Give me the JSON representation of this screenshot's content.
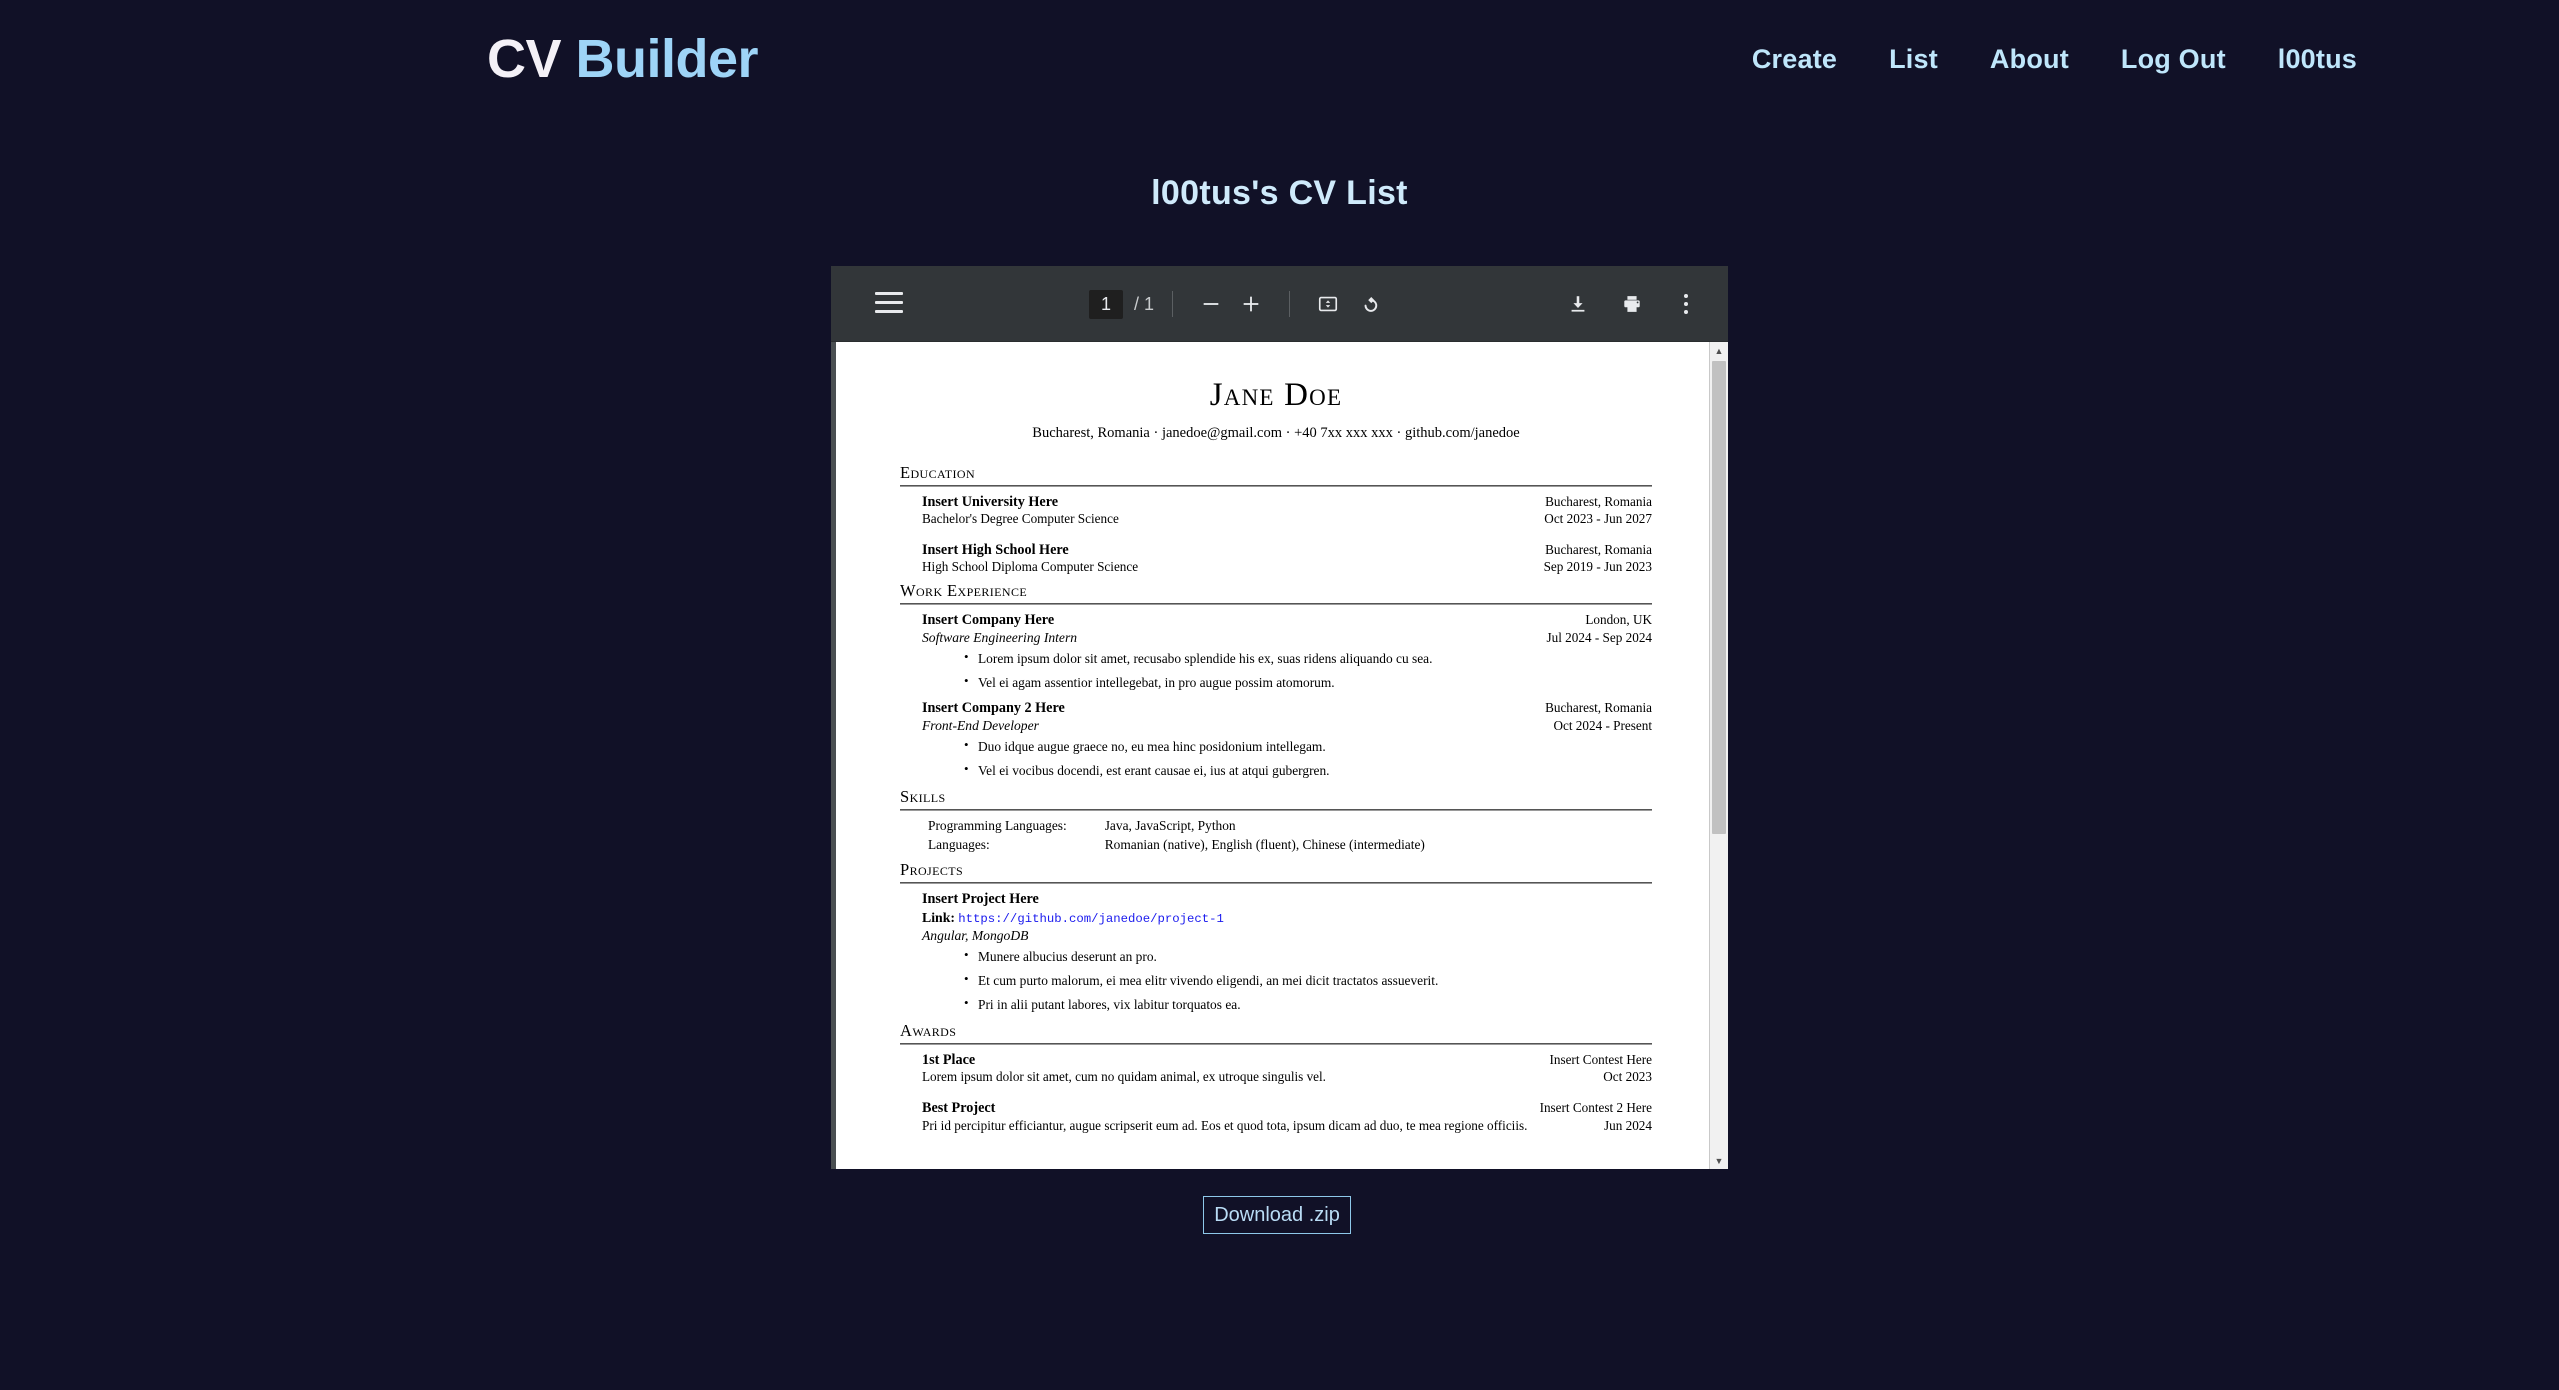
{
  "theme": {
    "background": "#111127",
    "accent": "#9ed4f7",
    "nav_link": "#bfe6fb",
    "toolbar_bg": "#323639"
  },
  "header": {
    "brand_first": "CV",
    "brand_second": "Builder",
    "nav": [
      {
        "label": "Create",
        "name": "nav-create"
      },
      {
        "label": "List",
        "name": "nav-list"
      },
      {
        "label": "About",
        "name": "nav-about"
      },
      {
        "label": "Log Out",
        "name": "nav-log-out"
      },
      {
        "label": "l00tus",
        "name": "nav-username"
      }
    ]
  },
  "page": {
    "title": "l00tus's CV List",
    "download_zip_label": "Download .zip"
  },
  "pdf_toolbar": {
    "menu_icon": "hamburger-menu-icon",
    "page_number": "1",
    "page_total": "/ 1",
    "zoom_out_icon": "minus-icon",
    "zoom_in_icon": "plus-icon",
    "fit_page_icon": "fit-to-page-icon",
    "rotate_icon": "rotate-counterclockwise-icon",
    "download_icon": "download-icon",
    "print_icon": "print-icon",
    "more_icon": "more-options-icon"
  },
  "cv": {
    "name": "Jane Doe",
    "contact": "Bucharest, Romania · janedoe@gmail.com · +40 7xx xxx xxx · github.com/janedoe",
    "sections": {
      "education": {
        "title": "Education",
        "entries": [
          {
            "title": "Insert University Here",
            "location": "Bucharest, Romania",
            "subtitle": "Bachelor's Degree Computer Science",
            "dates": "Oct 2023 - Jun 2027"
          },
          {
            "title": "Insert High School Here",
            "location": "Bucharest, Romania",
            "subtitle": "High School Diploma Computer Science",
            "dates": "Sep 2019 - Jun 2023"
          }
        ]
      },
      "work_experience": {
        "title": "Work Experience",
        "entries": [
          {
            "title": "Insert Company Here",
            "location": "London, UK",
            "subtitle": "Software Engineering Intern",
            "dates": "Jul 2024 - Sep 2024",
            "bullets": [
              "Lorem ipsum dolor sit amet, recusabo splendide his ex, suas ridens aliquando cu sea.",
              "Vel ei agam assentior intellegebat, in pro augue possim atomorum."
            ]
          },
          {
            "title": "Insert Company 2 Here",
            "location": "Bucharest, Romania",
            "subtitle": "Front-End Developer",
            "dates": "Oct 2024 - Present",
            "bullets": [
              "Duo idque augue graece no, eu mea hinc posidonium intellegam.",
              "Vel ei vocibus docendi, est erant causae ei, ius at atqui gubergren."
            ]
          }
        ]
      },
      "skills": {
        "title": "Skills",
        "rows": [
          {
            "key": "Programming Languages:",
            "value": "Java, JavaScript, Python"
          },
          {
            "key": "Languages:",
            "value": "Romanian (native), English (fluent), Chinese (intermediate)"
          }
        ]
      },
      "projects": {
        "title": "Projects",
        "entries": [
          {
            "title": "Insert Project Here",
            "link_label": "Link:",
            "link_url": "https://github.com/janedoe/project-1",
            "tech": "Angular, MongoDB",
            "bullets": [
              "Munere albucius deserunt an pro.",
              "Et cum purto malorum, ei mea elitr vivendo eligendi, an mei dicit tractatos assueverit.",
              "Pri in alii putant labores, vix labitur torquatos ea."
            ]
          }
        ]
      },
      "awards": {
        "title": "Awards",
        "entries": [
          {
            "title": "1st Place",
            "location": "Insert Contest Here",
            "subtitle": "Lorem ipsum dolor sit amet, cum no quidam animal, ex utroque singulis vel.",
            "dates": "Oct 2023"
          },
          {
            "title": "Best Project",
            "location": "Insert Contest 2 Here",
            "subtitle": "Pri id percipitur efficiantur, augue scripserit eum ad. Eos et quod tota, ipsum dicam ad duo, te mea regione officiis.",
            "dates": "Jun 2024"
          }
        ]
      }
    }
  }
}
